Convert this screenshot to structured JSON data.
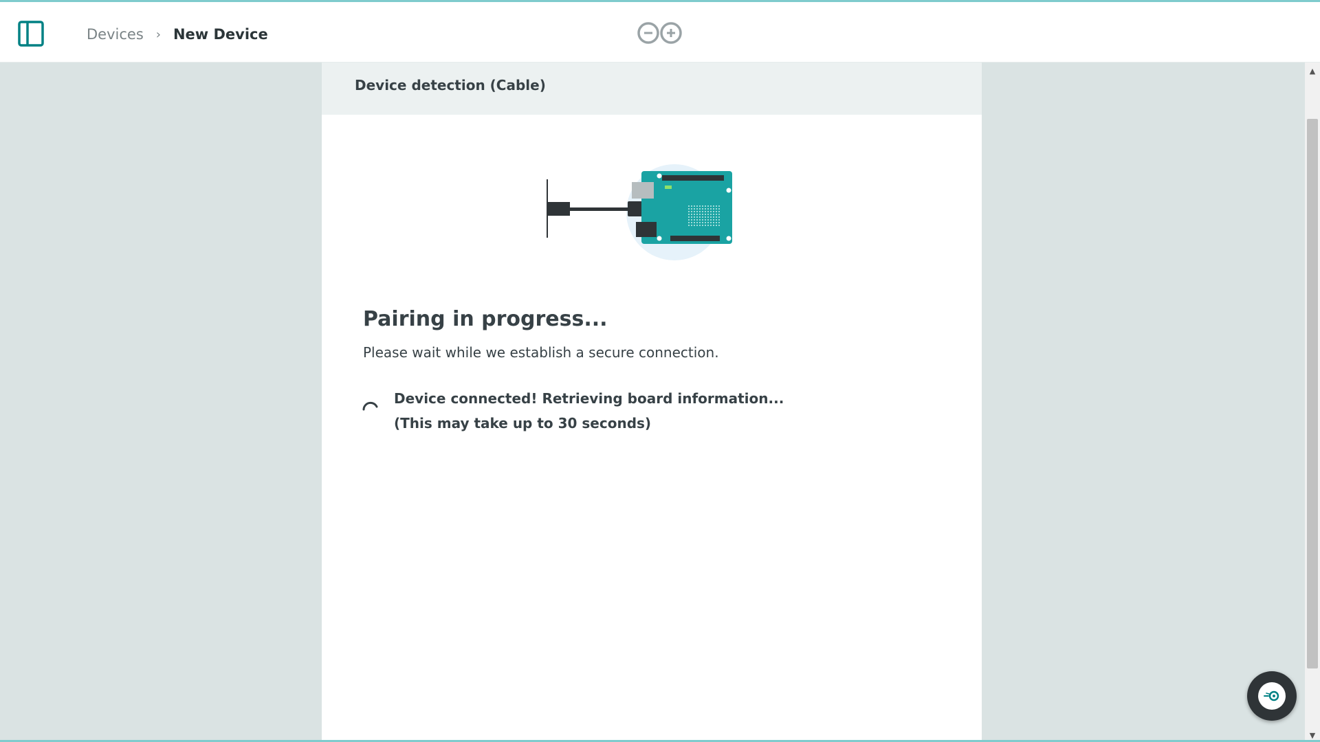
{
  "header": {
    "breadcrumb": {
      "parent": "Devices",
      "separator": "›",
      "current": "New Device"
    },
    "sidebar_toggle_icon": "sidebar-toggle-icon",
    "logo_icon": "arduino-logo"
  },
  "card": {
    "title": "Device detection (Cable)",
    "illustration": "usb-cable-board-illustration",
    "pairing_title": "Pairing in progress...",
    "pairing_subtitle": "Please wait while we establish a secure connection.",
    "status_line1": "Device connected! Retrieving board information...",
    "status_line2": "(This may take up to 30 seconds)"
  },
  "scrollbar": {
    "up": "▲",
    "down": "▼"
  },
  "chat": {
    "icon": "chat-assistant-icon"
  },
  "colors": {
    "accent": "#008184",
    "background": "#dae3e3",
    "card_header": "#ecf1f1",
    "text": "#374146"
  }
}
